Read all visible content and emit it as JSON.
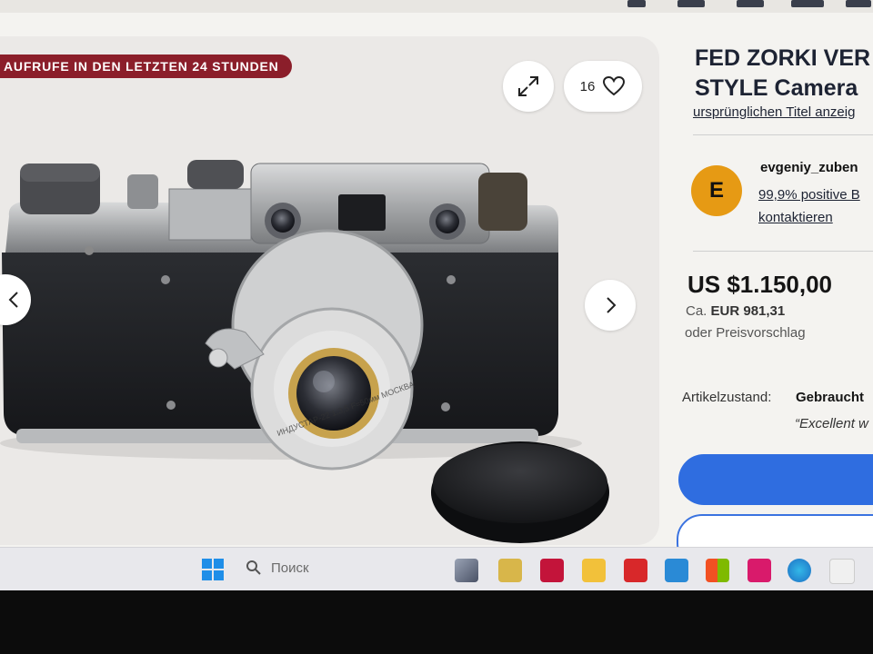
{
  "gallery": {
    "watchers_banner": "AUFRUFE IN DEN LETZTEN 24 STUNDEN",
    "watch_count": "16"
  },
  "camera_engravings": {
    "lens": "ИНДУСТАР-22 1:3,5 F=50мм МОСКВА"
  },
  "listing": {
    "title_line1": "FED ZORKI VER",
    "title_line2": "STYLE Camera",
    "original_title_link": "ursprünglichen Titel anzeig",
    "seller": {
      "avatar_letter": "E",
      "name": "evgeniy_zuben",
      "feedback": "99,9% positive B",
      "contact": "kontaktieren"
    },
    "price": "US $1.150,00",
    "price_eur_prefix": "Ca. ",
    "price_eur": "EUR 981,31",
    "best_offer": "oder Preisvorschlag",
    "condition_label": "Artikelzustand:",
    "condition_value": "Gebraucht",
    "condition_quote": "“Excellent w"
  },
  "taskbar": {
    "search_placeholder": "Поиск"
  },
  "colors": {
    "banner": "#8b1e2a",
    "avatar": "#e69a14",
    "buy_button": "#2f6de0",
    "title": "#1d2333"
  }
}
